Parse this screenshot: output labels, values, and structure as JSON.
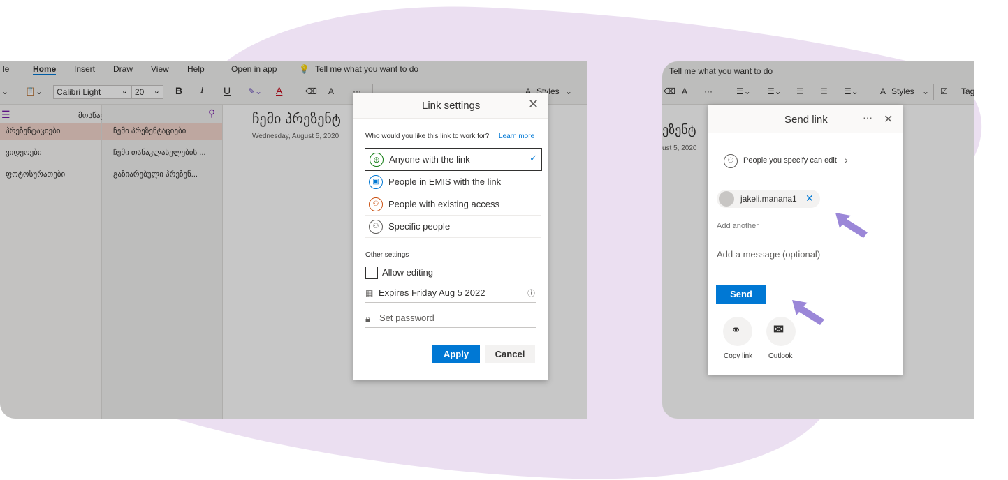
{
  "left": {
    "tabs": [
      "le",
      "Home",
      "Insert",
      "Draw",
      "View",
      "Help",
      "Open in app",
      "Tell me what you want to do"
    ],
    "font_name": "Calibri Light",
    "font_size": "20",
    "styles_label": "Styles",
    "sections_title": "მოსწავლეები",
    "sections": [
      "პრეზენტაციები",
      "ვიდეოები",
      "ფოტოსურათები"
    ],
    "pages": [
      "ჩემი პრეზენტაციები",
      "ჩემი თანაკლასელების ...",
      "გაზიარებული პრეზენ..."
    ],
    "page_title": "ჩემი პრეზენტ",
    "page_date": "Wednesday, August 5, 2020"
  },
  "link_settings": {
    "title": "Link settings",
    "question": "Who would you like this link to work for?",
    "learn_more": "Learn more",
    "options": [
      {
        "label": "Anyone with the link",
        "icon": "globe-icon",
        "color": "#107c10"
      },
      {
        "label": "People in EMIS with the link",
        "icon": "building-icon",
        "color": "#0078d4"
      },
      {
        "label": "People with existing access",
        "icon": "people-icon",
        "color": "#ca5010"
      },
      {
        "label": "Specific people",
        "icon": "people-icon",
        "color": "#605e5c"
      }
    ],
    "other_settings": "Other settings",
    "allow_editing": "Allow editing",
    "expires": "Expires Friday Aug 5 2022",
    "set_password": "Set password",
    "apply": "Apply",
    "cancel": "Cancel"
  },
  "right": {
    "tell_me": "Tell me what you want to do",
    "styles_label": "Styles",
    "tags_label": "Tag",
    "page_title": "ეზენტ",
    "page_date": "ust 5, 2020"
  },
  "send_link": {
    "title": "Send link",
    "permission": "People you specify can edit",
    "recipient": "jakeli.manana1",
    "add_another_placeholder": "Add another",
    "message_placeholder": "Add a message (optional)",
    "send": "Send",
    "copy_link": "Copy link",
    "outlook": "Outlook"
  },
  "colors": {
    "accent": "#0078d4",
    "blob": "#ebdff1",
    "arrow": "#9b87d8",
    "section_selected": "#f4d6cd"
  }
}
